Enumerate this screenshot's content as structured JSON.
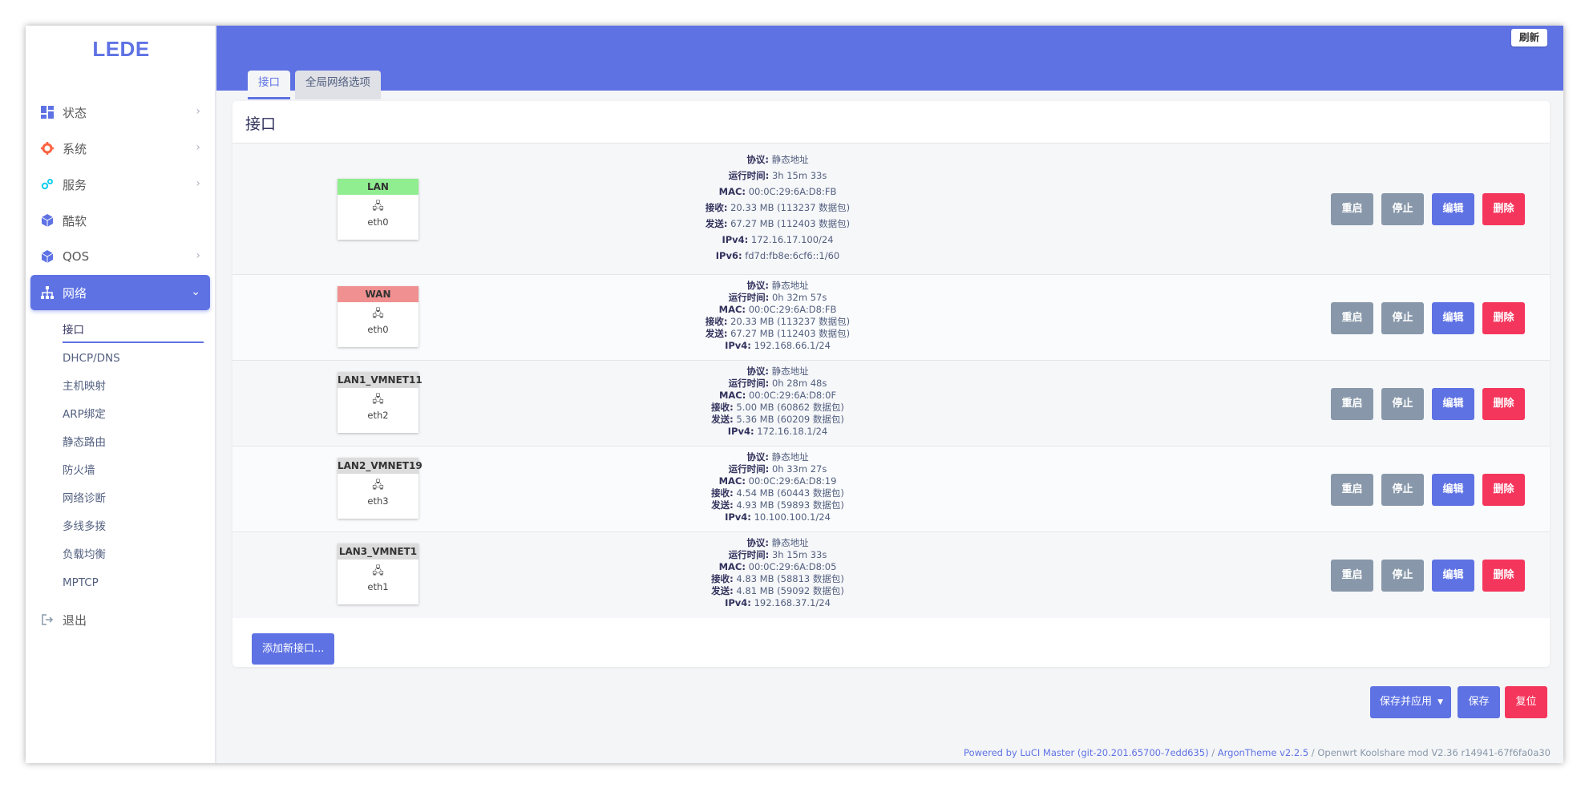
{
  "brand": "LEDE",
  "header": {
    "refresh": "刷新"
  },
  "tabs": [
    {
      "label": "接口"
    },
    {
      "label": "全局网络选项"
    }
  ],
  "sidebar": {
    "items": [
      {
        "label": "状态",
        "icon": "dashboard-icon"
      },
      {
        "label": "系统",
        "icon": "gear-icon"
      },
      {
        "label": "服务",
        "icon": "cogs-icon"
      },
      {
        "label": "酷软",
        "icon": "cube-icon"
      },
      {
        "label": "QOS",
        "icon": "cube-icon"
      },
      {
        "label": "网络",
        "icon": "sitemap-icon"
      }
    ],
    "submenu": [
      "接口",
      "DHCP/DNS",
      "主机映射",
      "ARP绑定",
      "静态路由",
      "防火墙",
      "网络诊断",
      "多线多拨",
      "负载均衡",
      "MPTCP"
    ],
    "logout": "退出"
  },
  "card": {
    "title": "接口"
  },
  "labels": {
    "protocol": "协议:",
    "uptime": "运行时间:",
    "mac": "MAC:",
    "rx": "接收:",
    "tx": "发送:",
    "ipv4": "IPv4:",
    "ipv6": "IPv6:"
  },
  "interfaces": [
    {
      "name": "LAN",
      "color": "#90ee90",
      "device": "eth0",
      "protocol": "静态地址",
      "uptime": "3h 15m 33s",
      "mac": "00:0C:29:6A:D8:FB",
      "rx": "20.33 MB (113237 数据包)",
      "tx": "67.27 MB (112403 数据包)",
      "ipv4": "172.16.17.100/24",
      "ipv6": "fd7d:fb8e:6cf6::1/60"
    },
    {
      "name": "WAN",
      "color": "#f09090",
      "device": "eth0",
      "protocol": "静态地址",
      "uptime": "0h 32m 57s",
      "mac": "00:0C:29:6A:D8:FB",
      "rx": "20.33 MB (113237 数据包)",
      "tx": "67.27 MB (112403 数据包)",
      "ipv4": "192.168.66.1/24"
    },
    {
      "name": "LAN1_VMNET11",
      "color": "#dcdcdc",
      "device": "eth2",
      "protocol": "静态地址",
      "uptime": "0h 28m 48s",
      "mac": "00:0C:29:6A:D8:0F",
      "rx": "5.00 MB (60862 数据包)",
      "tx": "5.36 MB (60209 数据包)",
      "ipv4": "172.16.18.1/24"
    },
    {
      "name": "LAN2_VMNET19",
      "color": "#dcdcdc",
      "device": "eth3",
      "protocol": "静态地址",
      "uptime": "0h 33m 27s",
      "mac": "00:0C:29:6A:D8:19",
      "rx": "4.54 MB (60443 数据包)",
      "tx": "4.93 MB (59893 数据包)",
      "ipv4": "10.100.100.1/24"
    },
    {
      "name": "LAN3_VMNET1",
      "color": "#dcdcdc",
      "device": "eth1",
      "protocol": "静态地址",
      "uptime": "3h 15m 33s",
      "mac": "00:0C:29:6A:D8:05",
      "rx": "4.83 MB (58813 数据包)",
      "tx": "4.81 MB (59092 数据包)",
      "ipv4": "192.168.37.1/24"
    }
  ],
  "actions": {
    "restart": "重启",
    "stop": "停止",
    "edit": "编辑",
    "delete": "删除"
  },
  "add_interface": "添加新接口...",
  "bottom": {
    "save_apply": "保存并应用",
    "save": "保存",
    "reset": "复位"
  },
  "footer": {
    "luci": "Powered by LuCI Master (git-20.201.65700-7edd635)",
    "sep1": " / ",
    "theme": "ArgonTheme v2.2.5",
    "sep2": " / ",
    "firmware": "Openwrt Koolshare mod V2.36 r14941-67f6fa0a30"
  }
}
